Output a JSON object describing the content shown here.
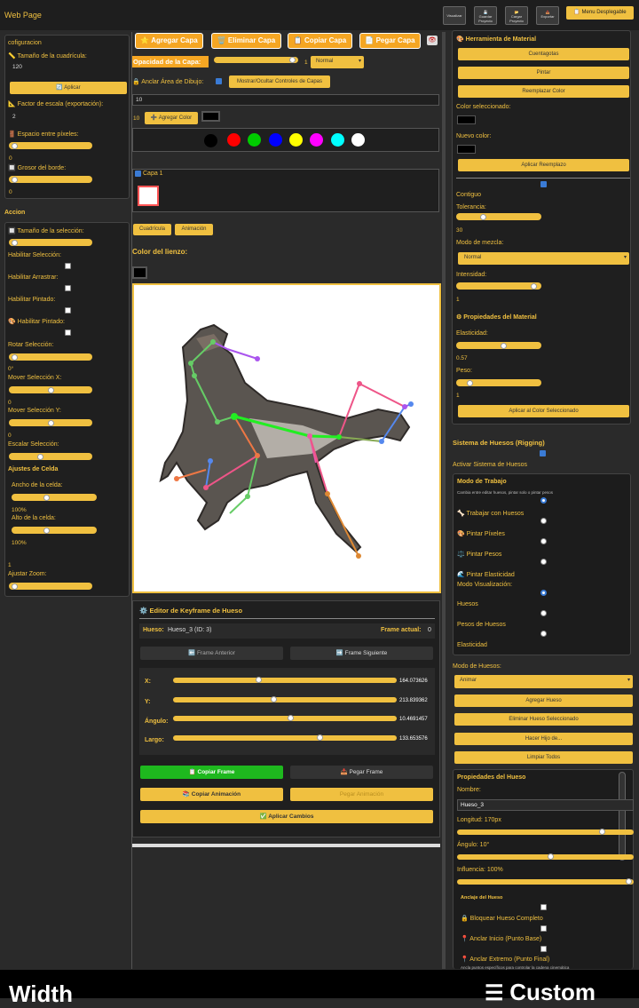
{
  "header": {
    "title": "Web Page",
    "buttons": [
      "Visualizar",
      "Guardar Proyecto",
      "Cargar Proyecto",
      "Exportar"
    ],
    "dropdown_label": "Menu Desplegable"
  },
  "left_config": {
    "section": "cofiguracion",
    "grid_size_label": "Tamaño de la cuadrícula:",
    "grid_size_value": "120",
    "apply_label": "Aplicar",
    "scale_label": "Factor de escala (exportación):",
    "scale_value": "2",
    "pixel_spacing_label": "Espacio entre píxeles:",
    "pixel_spacing_value": "0",
    "border_label": "Grosor del borde:",
    "border_value": "0"
  },
  "action": {
    "section": "Accion",
    "sel_size_label": "Tamaño de la selección:",
    "enable_sel": "Habilitar Selección:",
    "enable_drag": "Habilitar Arrastrar:",
    "enable_paint": "Habilitar Pintado:",
    "enable_painted": "Habilitar Pintado:",
    "rotate_label": "Rotar Selección:",
    "rotate_value": "0°",
    "move_x_label": "Mover Selección X:",
    "move_x_value": "0",
    "move_y_label": "Mover Selección Y:",
    "move_y_value": "0",
    "scale_label": "Escalar Selección:",
    "cell_section": "Ajustes de Celda",
    "cell_width_label": "Ancho de la celda:",
    "cell_width_value": "100%",
    "cell_height_label": "Alto de la celda:",
    "cell_height_value": "100%",
    "zoom_value": "1",
    "zoom_label": "Ajustar Zoom:"
  },
  "layers": {
    "add": "Agregar Capa",
    "delete": "Eliminar Capa",
    "copy": "Copiar Capa",
    "paste": "Pegar Capa",
    "opacity_label": "Opacidad de la Capa:",
    "opacity_value": "1",
    "blend": "Normal",
    "anchor_label": "Anclar Área de Dibujo:",
    "toggle_controls": "Mostrar/Ocultar Controles de Capas",
    "value_10": "10",
    "value_10b": "10",
    "add_color": "Agregar Color",
    "palette": [
      "#000000",
      "#ff0000",
      "#00cc00",
      "#0000ff",
      "#ffff00",
      "#ff00ff",
      "#00ffff",
      "#ffffff"
    ],
    "layer_name": "Capa 1",
    "grid_btn": "Cuadrícula",
    "anim_btn": "Animación",
    "canvas_color_label": "Color del lienzo:"
  },
  "keyframe": {
    "title": "Editor de Keyframe de Hueso",
    "bone_label": "Hueso:",
    "bone_value": "Hueso_3 (ID: 3)",
    "frame_label": "Frame actual:",
    "frame_value": "0",
    "prev": "Frame Anterior",
    "next": "Frame Siguiente",
    "x_label": "X:",
    "x_value": "164.073626",
    "y_label": "Y:",
    "y_value": "213.839362",
    "angle_label": "Ángulo:",
    "angle_value": "10.4691457",
    "length_label": "Largo:",
    "length_value": "133.653576",
    "copy_frame": "Copiar Frame",
    "paste_frame": "Pegar Frame",
    "copy_anim": "Copiar Animación",
    "paste_anim": "Pegar Animación",
    "apply": "Aplicar Cambios"
  },
  "material": {
    "title": "Herramienta de Material",
    "dropper": "Cuentagotas",
    "paint": "Pintar",
    "replace_color": "Reemplazar Color",
    "selected_color_label": "Color seleccionado:",
    "new_color_label": "Nuevo color:",
    "apply_replace": "Aplicar Reemplazo",
    "contiguous": "Contiguo",
    "tolerance_label": "Tolerancia:",
    "tolerance_value": "30",
    "blend_label": "Modo de mezcla:",
    "blend_value": "Normal",
    "intensity_label": "Intensidad:",
    "intensity_value": "1",
    "props_title": "Propiedades del Material",
    "elasticity_label": "Elasticidad:",
    "elasticity_value": "0.57",
    "weight_label": "Peso:",
    "weight_value": "1",
    "apply_selected": "Aplicar al Color Seleccionado"
  },
  "rigging": {
    "title": "Sistema de Huesos (Rigging)",
    "activate": "Activar Sistema de Huesos",
    "work_mode": "Modo de Trabajo",
    "work_hint": "Cambia entre editar huesos, pintar solo o pintar pesos",
    "modes": [
      "Trabajar con Huesos",
      "Pintar Píxeles",
      "Pintar Pesos",
      "Pintar Elasticidad"
    ],
    "view_mode": "Modo Visualización:",
    "view_options": [
      "Huesos",
      "Pesos de Huesos",
      "Elasticidad"
    ],
    "bone_mode_label": "Modo de Huesos:",
    "bone_mode_value": "Animar",
    "add_bone": "Agregar Hueso",
    "delete_bone": "Eliminar Hueso Seleccionado",
    "make_child": "Hacer Hijo de...",
    "clear_all": "Limpiar Todos",
    "bone_props": "Propiedades del Hueso",
    "name_label": "Nombre:",
    "name_value": "Hueso_3",
    "length_label": "Longitud: 170px",
    "angle_label": "Ángulo: 10°",
    "influence_label": "Influencia: 100%",
    "anchor_title": "Anclaje del Hueso",
    "lock_full": "Bloquear Hueso Completo",
    "anchor_start": "Anclar Inicio (Punto Base)",
    "anchor_end": "Anclar Extremo (Punto Final)",
    "anchor_hint": "Ancla puntos específicos para controlar la cadena cinemática"
  },
  "footer": {
    "left": "Width",
    "right": "Custom"
  }
}
